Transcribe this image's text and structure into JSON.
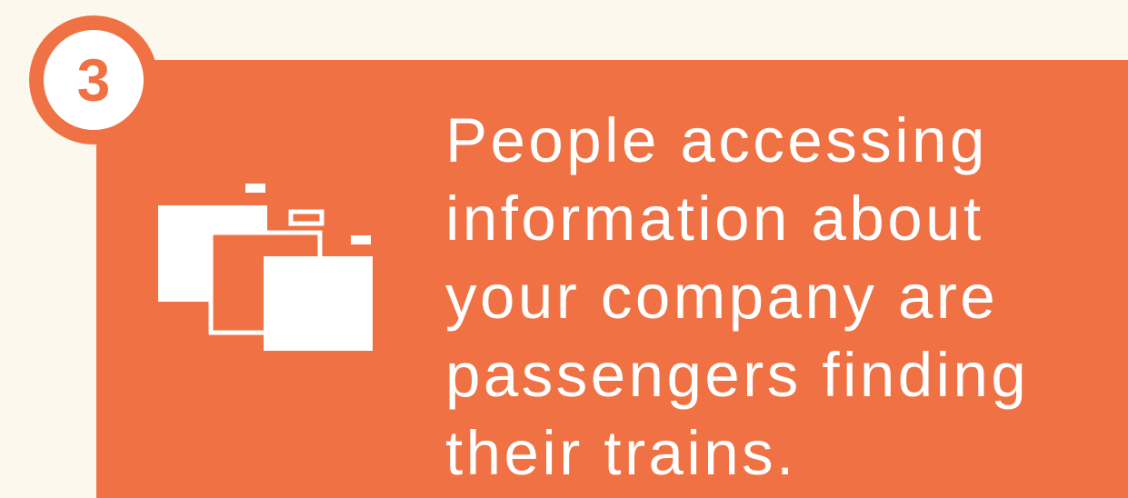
{
  "step": {
    "number": "3"
  },
  "card": {
    "icon": "folders-icon",
    "lines": [
      "People accessing",
      "information about",
      "your company are",
      "passengers finding",
      "their trains."
    ]
  },
  "colors": {
    "background": "#fdf8ee",
    "accent": "#f07244",
    "text": "#ffffff"
  }
}
